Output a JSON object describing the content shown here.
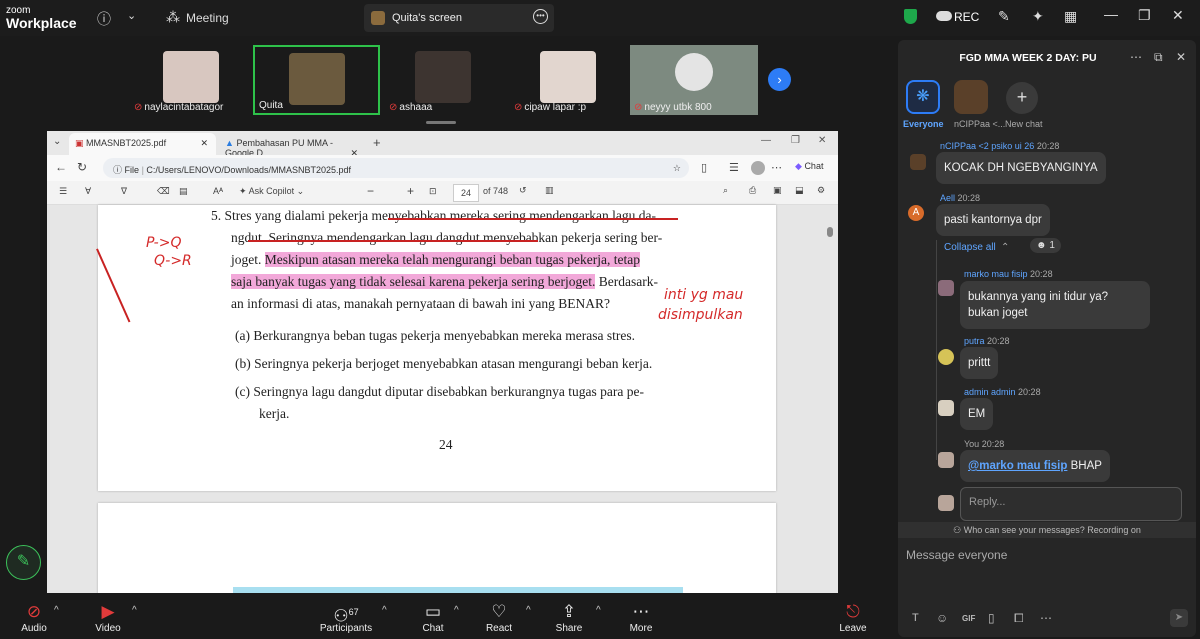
{
  "app": {
    "logo_top": "zoom",
    "logo_bottom": "Workplace",
    "meeting_label": "Meeting",
    "share_label": "Quita's screen",
    "rec_label": "REC"
  },
  "participants": [
    {
      "name": "naylacintabatagor"
    },
    {
      "name": "Quita"
    },
    {
      "name": "ashaaa"
    },
    {
      "name": "cipaw lapar :p"
    },
    {
      "name": "neyyy utbk 800"
    }
  ],
  "browser": {
    "tab1": "MMASNBT2025.pdf",
    "tab2": "Pembahasan PU MMA - Google D",
    "url": "C:/Users/LENOVO/Downloads/MMASNBT2025.pdf",
    "file_label": "File",
    "chat_label": "Chat",
    "ask_copilot": "Ask Copilot",
    "page_num": "24",
    "page_total": "of 748"
  },
  "doc": {
    "l1": "5.  Stres yang dialami pekerja menyebabkan mereka sering mendengarkan lagu da-",
    "l2a": "ngdut.  Seringnya mendengarkan lagu dangdut ",
    "l2b": "menyebabkan pekerja sering ber-",
    "l3a": "joget.  ",
    "l3b": "Meskipun atasan mereka telah mengurangi beban tugas pekerja, tetap",
    "l4a": "saja banyak tugas yang tidak selesai karena pekerja sering berjoget.",
    "l4b": " Berdasark-",
    "l5": "an informasi di atas, manakah pernyataan di bawah ini yang BENAR?",
    "oa": "(a)  Berkurangnya beban tugas pekerja menyebabkan mereka merasa stres.",
    "ob": "(b)  Seringnya pekerja berjoget menyebabkan atasan mengurangi beban kerja.",
    "oc1": "(c)  Seringnya lagu dangdut diputar disebabkan berkurangnya tugas para pe-",
    "oc2": "kerja.",
    "page_number": "24"
  },
  "annotations": {
    "a1": "P->Q",
    "a2": "Q->R",
    "a3": "inti yg mau",
    "a4": "disimpulkan"
  },
  "chat": {
    "title": "FGD MMA WEEK 2 DAY: PU",
    "tabs": [
      "Everyone",
      "nCIPPaa <...",
      "New chat"
    ],
    "messages": [
      {
        "name": "nCIPPaa <2 psiko ui 26",
        "time": "20:28",
        "text": "KOCAK DH NGEBYANGINYA"
      },
      {
        "name": "Aell",
        "time": "20:28",
        "text": "pasti kantornya dpr"
      },
      {
        "name": "marko mau fisip",
        "time": "20:28",
        "text1": "bukannya yang ini tidur ya?",
        "text2": "bukan joget"
      },
      {
        "name": "putra",
        "time": "20:28",
        "text": "prittt"
      },
      {
        "name": "admin admin",
        "time": "20:28",
        "text": "EM"
      },
      {
        "name": "You",
        "time": "20:28",
        "mention": "@marko mau fisip",
        "text": " BHAP"
      }
    ],
    "collapse_all": "Collapse all",
    "reaction_count": "1",
    "reply_placeholder": "Reply...",
    "privacy_note": "Who can see your messages? Recording on",
    "message_placeholder": "Message everyone"
  },
  "bottombar": {
    "audio": "Audio",
    "video": "Video",
    "participants": "Participants",
    "participants_count": "67",
    "chat": "Chat",
    "react": "React",
    "share": "Share",
    "more": "More",
    "leave": "Leave"
  }
}
